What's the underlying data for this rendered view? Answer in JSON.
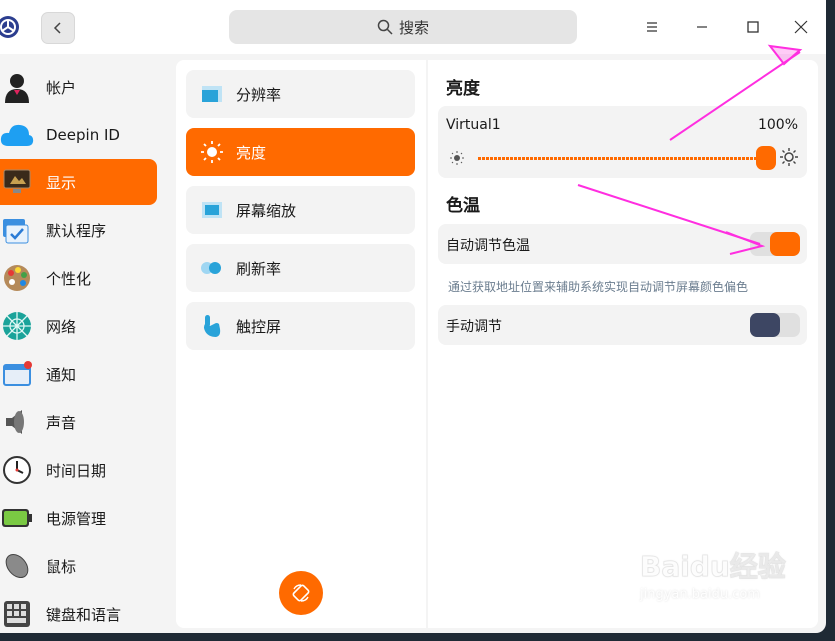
{
  "search": {
    "label": "搜索"
  },
  "sidebar": {
    "items": [
      {
        "label": "帐户",
        "icon": "user-icon"
      },
      {
        "label": "Deepin ID",
        "icon": "cloud-icon"
      },
      {
        "label": "显示",
        "icon": "monitor-icon",
        "active": true
      },
      {
        "label": "默认程序",
        "icon": "default-apps-icon"
      },
      {
        "label": "个性化",
        "icon": "palette-icon"
      },
      {
        "label": "网络",
        "icon": "network-icon"
      },
      {
        "label": "通知",
        "icon": "notification-icon"
      },
      {
        "label": "声音",
        "icon": "speaker-icon"
      },
      {
        "label": "时间日期",
        "icon": "clock-icon"
      },
      {
        "label": "电源管理",
        "icon": "battery-icon"
      },
      {
        "label": "鼠标",
        "icon": "mouse-icon"
      },
      {
        "label": "键盘和语言",
        "icon": "keyboard-icon"
      }
    ]
  },
  "submenu": {
    "items": [
      {
        "label": "分辨率",
        "icon": "resolution-icon"
      },
      {
        "label": "亮度",
        "icon": "sun-icon",
        "active": true
      },
      {
        "label": "屏幕缩放",
        "icon": "scale-icon"
      },
      {
        "label": "刷新率",
        "icon": "refresh-rate-icon"
      },
      {
        "label": "触控屏",
        "icon": "touch-icon"
      }
    ]
  },
  "brightness": {
    "title": "亮度",
    "monitor_name": "Virtual1",
    "value_text": "100%",
    "value": 1.0
  },
  "color_temp": {
    "title": "色温",
    "auto_label": "自动调节色温",
    "auto_enabled": true,
    "hint": "通过获取地址位置来辅助系统实现自动调节屏幕颜色偏色",
    "manual_label": "手动调节",
    "manual_enabled": true
  },
  "watermark": {
    "brand": "Baidu经验",
    "url": "jingyan.baidu.com"
  },
  "colors": {
    "accent": "#ff6a00",
    "annotation": "#ff2ee0",
    "toggle_dark": "#3d4663"
  }
}
